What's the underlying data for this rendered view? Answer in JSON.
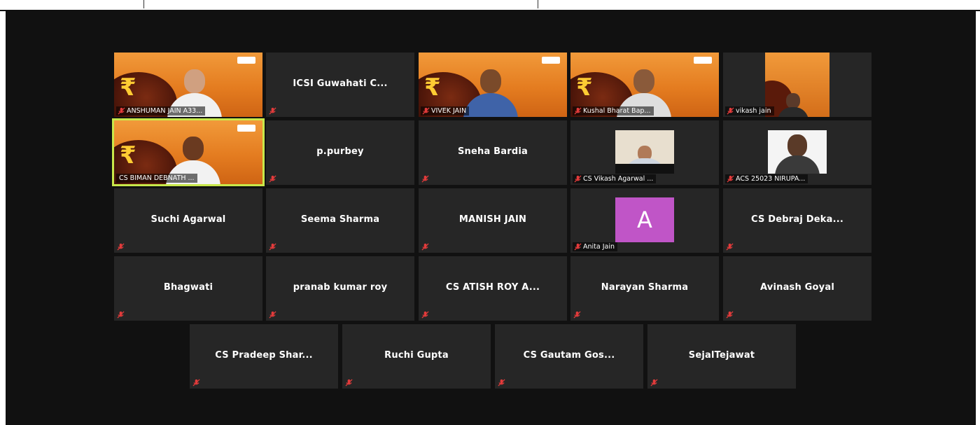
{
  "participants": [
    {
      "name": "ANSHUMAN JAIN A33...",
      "video": true
    },
    {
      "name": "ICSI Guwahati C...",
      "video": false
    },
    {
      "name": "VIVEK JAIN",
      "video": true
    },
    {
      "name": "Kushal Bharat Bap...",
      "video": true
    },
    {
      "name": "vikash jain",
      "video": true
    },
    {
      "name": "CS BIMAN DEBNATH ...",
      "video": true,
      "speaking": true
    },
    {
      "name": "p.purbey",
      "video": false
    },
    {
      "name": "Sneha Bardia",
      "video": false
    },
    {
      "name": "CS Vikash Agarwal ...",
      "video": true
    },
    {
      "name": "ACS 25023 NIRUPA...",
      "video": true
    },
    {
      "name": "Suchi Agarwal",
      "video": false
    },
    {
      "name": "Seema Sharma",
      "video": false
    },
    {
      "name": "MANISH JAIN",
      "video": false
    },
    {
      "name": "Anita Jain",
      "avatar_letter": "A"
    },
    {
      "name": "CS Debraj Deka...",
      "video": false
    },
    {
      "name": "Bhagwati",
      "video": false
    },
    {
      "name": "pranab kumar roy",
      "video": false
    },
    {
      "name": "CS ATISH ROY A...",
      "video": false
    },
    {
      "name": "Narayan Sharma",
      "video": false
    },
    {
      "name": "Avinash Goyal",
      "video": false
    },
    {
      "name": "CS Pradeep Shar...",
      "video": false
    },
    {
      "name": "Ruchi Gupta",
      "video": false
    },
    {
      "name": "CS Gautam Gos...",
      "video": false
    },
    {
      "name": "SejalTejawat",
      "video": false
    }
  ],
  "colors": {
    "background": "#111111",
    "tile": "#262626",
    "speaking_border": "#c8e84a",
    "muted_icon": "#e23b3b",
    "avatar": "#c055c7"
  },
  "icons": {
    "muted": "mic-muted-icon"
  }
}
